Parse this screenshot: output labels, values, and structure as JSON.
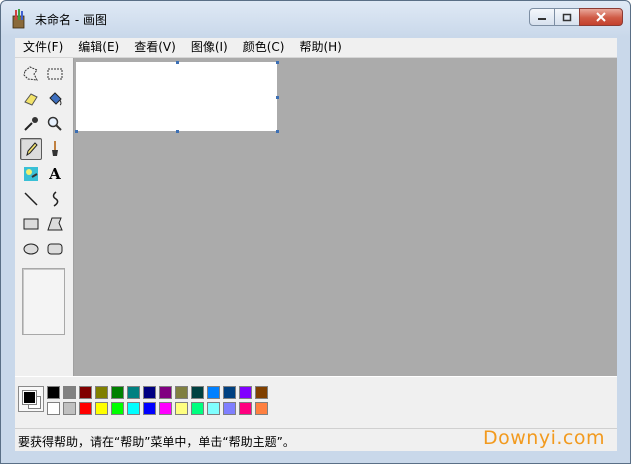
{
  "window": {
    "title": "未命名 - 画图"
  },
  "menu": [
    {
      "label": "文件(F)"
    },
    {
      "label": "编辑(E)"
    },
    {
      "label": "查看(V)"
    },
    {
      "label": "图像(I)"
    },
    {
      "label": "颜色(C)"
    },
    {
      "label": "帮助(H)"
    }
  ],
  "tools": [
    {
      "name": "free-select-icon"
    },
    {
      "name": "rect-select-icon"
    },
    {
      "name": "eraser-icon"
    },
    {
      "name": "fill-bucket-icon"
    },
    {
      "name": "color-picker-icon"
    },
    {
      "name": "magnifier-icon"
    },
    {
      "name": "pencil-icon",
      "active": true
    },
    {
      "name": "brush-icon"
    },
    {
      "name": "airbrush-icon"
    },
    {
      "name": "text-icon",
      "label": "A"
    },
    {
      "name": "line-icon"
    },
    {
      "name": "curve-icon"
    },
    {
      "name": "rectangle-icon"
    },
    {
      "name": "polygon-icon"
    },
    {
      "name": "ellipse-icon"
    },
    {
      "name": "rounded-rectangle-icon"
    }
  ],
  "colors": {
    "foreground": "#000000",
    "background": "#ffffff",
    "palette_top": [
      "#000000",
      "#808080",
      "#800000",
      "#808000",
      "#008000",
      "#008080",
      "#000080",
      "#800080",
      "#808040",
      "#004040",
      "#0080ff",
      "#004080",
      "#8000ff",
      "#804000"
    ],
    "palette_bottom": [
      "#ffffff",
      "#c0c0c0",
      "#ff0000",
      "#ffff00",
      "#00ff00",
      "#00ffff",
      "#0000ff",
      "#ff00ff",
      "#ffff80",
      "#00ff80",
      "#80ffff",
      "#8080ff",
      "#ff0080",
      "#ff8040"
    ]
  },
  "status": {
    "text": "要获得帮助，请在“帮助”菜单中，单击“帮助主题”。"
  },
  "watermark": {
    "text": "Downyi.com"
  }
}
